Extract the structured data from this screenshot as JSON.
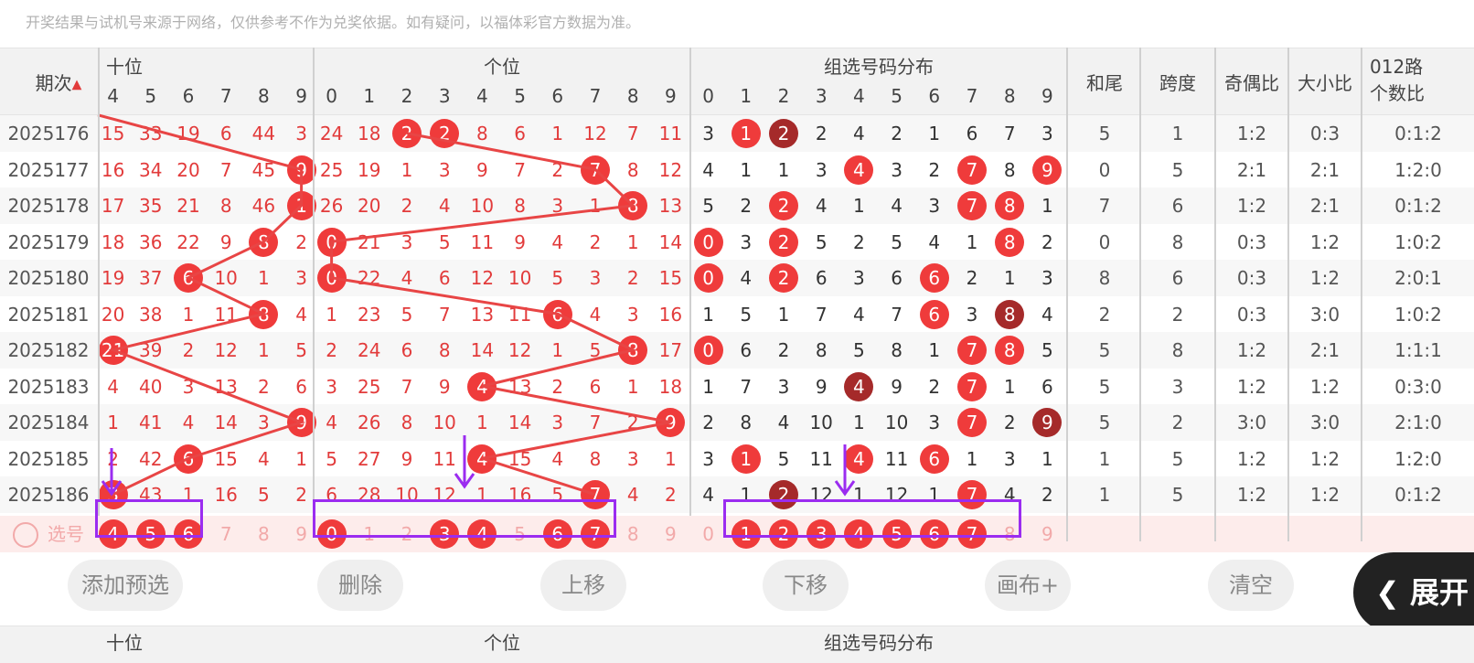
{
  "notice": "开奖结果与试机号来源于网络，仅供参考不作为兑奖依据。如有疑问，以福体彩官方数据为准。",
  "header": {
    "period": "期次",
    "shi": "十位",
    "ge": "个位",
    "zuxuan": "组选号码分布",
    "hewei": "和尾",
    "kuadu": "跨度",
    "jiou": "奇偶比",
    "daxiao": "大小比",
    "lu012_a": "012路",
    "lu012_b": "个数比"
  },
  "shi_digits": [
    "4",
    "5",
    "6",
    "7",
    "8",
    "9"
  ],
  "ge_digits": [
    "0",
    "1",
    "2",
    "3",
    "4",
    "5",
    "6",
    "7",
    "8",
    "9"
  ],
  "zx_digits": [
    "0",
    "1",
    "2",
    "3",
    "4",
    "5",
    "6",
    "7",
    "8",
    "9"
  ],
  "rows": [
    {
      "p": "2025176",
      "shi": [
        "15",
        "33",
        "19",
        "6",
        "44",
        "3"
      ],
      "ge": [
        "24",
        "18",
        "2",
        "2",
        "8",
        "6",
        "1",
        "12",
        "7",
        "11"
      ],
      "zx": [
        "3",
        "1",
        "2",
        "2",
        "4",
        "2",
        "1",
        "6",
        "7",
        "3"
      ],
      "hw": "5",
      "kd": "1",
      "jo": "1:2",
      "dx": "0:3",
      "lu": "0:1:2"
    },
    {
      "p": "2025177",
      "shi": [
        "16",
        "34",
        "20",
        "7",
        "45",
        "9"
      ],
      "ge": [
        "25",
        "19",
        "1",
        "3",
        "9",
        "7",
        "2",
        "7",
        "8",
        "12"
      ],
      "zx": [
        "4",
        "1",
        "1",
        "3",
        "4",
        "3",
        "2",
        "7",
        "8",
        "9"
      ],
      "hw": "0",
      "kd": "5",
      "jo": "2:1",
      "dx": "2:1",
      "lu": "1:2:0"
    },
    {
      "p": "2025178",
      "shi": [
        "17",
        "35",
        "21",
        "8",
        "46",
        "1"
      ],
      "ge": [
        "26",
        "20",
        "2",
        "4",
        "10",
        "8",
        "3",
        "1",
        "8",
        "13"
      ],
      "zx": [
        "5",
        "2",
        "2",
        "4",
        "1",
        "4",
        "3",
        "7",
        "8",
        "1"
      ],
      "hw": "7",
      "kd": "6",
      "jo": "1:2",
      "dx": "2:1",
      "lu": "0:1:2"
    },
    {
      "p": "2025179",
      "shi": [
        "18",
        "36",
        "22",
        "9",
        "8",
        "2"
      ],
      "ge": [
        "0",
        "21",
        "3",
        "5",
        "11",
        "9",
        "4",
        "2",
        "1",
        "14"
      ],
      "zx": [
        "0",
        "3",
        "2",
        "5",
        "2",
        "5",
        "4",
        "1",
        "8",
        "2"
      ],
      "hw": "0",
      "kd": "8",
      "jo": "0:3",
      "dx": "1:2",
      "lu": "1:0:2"
    },
    {
      "p": "2025180",
      "shi": [
        "19",
        "37",
        "6",
        "10",
        "1",
        "3"
      ],
      "ge": [
        "0",
        "22",
        "4",
        "6",
        "12",
        "10",
        "5",
        "3",
        "2",
        "15"
      ],
      "zx": [
        "0",
        "4",
        "2",
        "6",
        "3",
        "6",
        "6",
        "2",
        "1",
        "3"
      ],
      "hw": "8",
      "kd": "6",
      "jo": "0:3",
      "dx": "1:2",
      "lu": "2:0:1"
    },
    {
      "p": "2025181",
      "shi": [
        "20",
        "38",
        "1",
        "11",
        "8",
        "4"
      ],
      "ge": [
        "1",
        "23",
        "5",
        "7",
        "13",
        "11",
        "6",
        "4",
        "3",
        "16"
      ],
      "zx": [
        "1",
        "5",
        "1",
        "7",
        "4",
        "7",
        "6",
        "3",
        "8",
        "4"
      ],
      "hw": "2",
      "kd": "2",
      "jo": "0:3",
      "dx": "3:0",
      "lu": "1:0:2"
    },
    {
      "p": "2025182",
      "shi": [
        "21",
        "39",
        "2",
        "12",
        "1",
        "5"
      ],
      "ge": [
        "2",
        "24",
        "6",
        "8",
        "14",
        "12",
        "1",
        "5",
        "8",
        "17"
      ],
      "zx": [
        "0",
        "6",
        "2",
        "8",
        "5",
        "8",
        "1",
        "7",
        "8",
        "5"
      ],
      "hw": "5",
      "kd": "8",
      "jo": "1:2",
      "dx": "2:1",
      "lu": "1:1:1"
    },
    {
      "p": "2025183",
      "shi": [
        "4",
        "40",
        "3",
        "13",
        "2",
        "6"
      ],
      "ge": [
        "3",
        "25",
        "7",
        "9",
        "4",
        "13",
        "2",
        "6",
        "1",
        "18"
      ],
      "zx": [
        "1",
        "7",
        "3",
        "9",
        "4",
        "9",
        "2",
        "7",
        "1",
        "6"
      ],
      "hw": "5",
      "kd": "3",
      "jo": "1:2",
      "dx": "1:2",
      "lu": "0:3:0"
    },
    {
      "p": "2025184",
      "shi": [
        "1",
        "41",
        "4",
        "14",
        "3",
        "9"
      ],
      "ge": [
        "4",
        "26",
        "8",
        "10",
        "1",
        "14",
        "3",
        "7",
        "2",
        "9"
      ],
      "zx": [
        "2",
        "8",
        "4",
        "10",
        "1",
        "10",
        "3",
        "7",
        "2",
        "9"
      ],
      "hw": "5",
      "kd": "2",
      "jo": "3:0",
      "dx": "3:0",
      "lu": "2:1:0"
    },
    {
      "p": "2025185",
      "shi": [
        "2",
        "42",
        "6",
        "15",
        "4",
        "1"
      ],
      "ge": [
        "5",
        "27",
        "9",
        "11",
        "4",
        "15",
        "4",
        "8",
        "3",
        "1"
      ],
      "zx": [
        "3",
        "1",
        "5",
        "11",
        "4",
        "11",
        "6",
        "1",
        "3",
        "1"
      ],
      "hw": "1",
      "kd": "5",
      "jo": "1:2",
      "dx": "1:2",
      "lu": "1:2:0"
    },
    {
      "p": "2025186",
      "shi": [
        "3",
        "43",
        "1",
        "16",
        "5",
        "2"
      ],
      "ge": [
        "6",
        "28",
        "10",
        "12",
        "1",
        "16",
        "5",
        "7",
        "4",
        "2"
      ],
      "zx": [
        "4",
        "1",
        "2",
        "12",
        "1",
        "12",
        "1",
        "7",
        "4",
        "2"
      ],
      "hw": "1",
      "kd": "5",
      "jo": "1:2",
      "dx": "1:2",
      "lu": "0:1:2"
    }
  ],
  "hit_shi": [
    null,
    5,
    5,
    4,
    2,
    4,
    0,
    null,
    5,
    2,
    0
  ],
  "hit_ge": [
    2,
    7,
    8,
    0,
    0,
    6,
    8,
    4,
    9,
    4,
    7
  ],
  "hit_ge_extra": [
    [
      3
    ],
    [],
    [],
    [],
    [],
    [],
    [],
    [],
    [],
    [],
    []
  ],
  "hit_zx": [
    [
      1,
      2
    ],
    [
      4,
      7,
      9
    ],
    [
      2,
      7,
      8
    ],
    [
      0,
      2,
      8
    ],
    [
      0,
      2,
      6
    ],
    [
      6,
      8
    ],
    [
      0,
      7,
      8
    ],
    [
      4,
      7
    ],
    [
      7,
      9
    ],
    [
      1,
      4,
      6
    ],
    [
      2,
      7
    ]
  ],
  "dark_zx": [
    [
      0,
      2
    ],
    [],
    [],
    [],
    [],
    [
      1,
      8
    ],
    [],
    [
      0,
      4
    ],
    [
      1,
      9
    ],
    [],
    [
      0,
      2
    ]
  ],
  "pick": {
    "label": "选号",
    "shi": [
      "4",
      "5",
      "6",
      "7",
      "8",
      "9"
    ],
    "shi_sel": [
      0,
      1,
      2
    ],
    "ge": [
      "0",
      "1",
      "2",
      "3",
      "4",
      "5",
      "6",
      "7",
      "8",
      "9"
    ],
    "ge_sel": [
      0,
      3,
      4,
      6,
      7
    ],
    "zx": [
      "0",
      "1",
      "2",
      "3",
      "4",
      "5",
      "6",
      "7",
      "8",
      "9"
    ],
    "zx_sel": [
      1,
      2,
      3,
      4,
      5,
      6,
      7
    ]
  },
  "buttons": {
    "add": "添加预选",
    "del": "删除",
    "up": "上移",
    "down": "下移",
    "canvas": "画布+",
    "clear": "清空",
    "expand": "展开"
  },
  "colors": {
    "red": "#ef3b3b",
    "dark_red": "#a52a2a",
    "purple": "#9b2cf0",
    "line": "#e84545"
  }
}
